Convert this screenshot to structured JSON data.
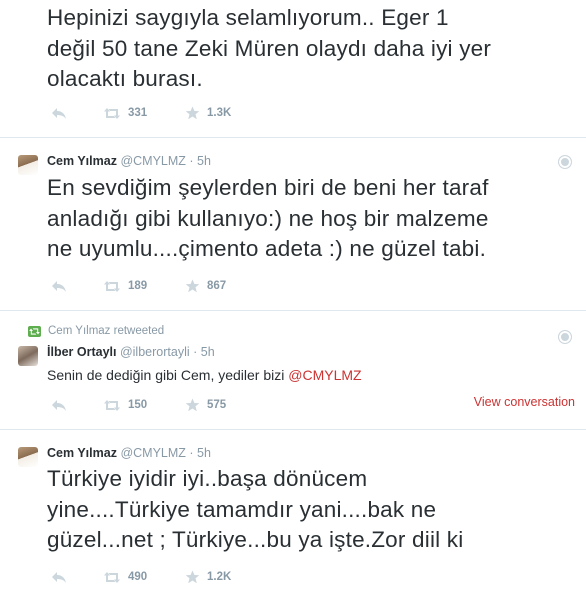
{
  "colors": {
    "accent": "#cc3333",
    "muted": "#8899a6",
    "text": "#292f33",
    "divider": "#e1e8ed"
  },
  "icons": {
    "reply": "reply-icon",
    "retweet": "retweet-icon",
    "favorite": "star-icon",
    "globe": "globe-icon"
  },
  "tweets": [
    {
      "text_lines": [
        "Hepinizi saygıyla selamlıyorum.. Eger 1",
        "değil 50 tane Zeki Müren olaydı daha iyi yer",
        "olacaktı burası."
      ],
      "retweets": "331",
      "favorites": "1.3K"
    },
    {
      "fullname": "Cem Yılmaz",
      "screen_name": "@CMYLMZ",
      "dot": "·",
      "time": "5h",
      "text_lines": [
        "En sevdiğim şeylerden biri de beni her taraf",
        "anladığı gibi kullanıyo:) ne hoş bir malzeme",
        "ne uyumlu....çimento adeta :) ne güzel tabi."
      ],
      "retweets": "189",
      "favorites": "867"
    },
    {
      "retweeted_by": "Cem Yılmaz retweeted",
      "fullname": "İlber Ortaylı",
      "screen_name": "@ilberortayli",
      "dot": "·",
      "time": "5h",
      "text": "Senin de dediğin gibi Cem, yediler bizi ",
      "mention": "@CMYLMZ",
      "retweets": "150",
      "favorites": "575",
      "view_conversation": "View conversation"
    },
    {
      "fullname": "Cem Yılmaz",
      "screen_name": "@CMYLMZ",
      "dot": "·",
      "time": "5h",
      "text_lines": [
        "Türkiye iyidir iyi..başa dönücem",
        "yine....Türkiye tamamdır yani....bak ne",
        "güzel...net ; Türkiye...bu ya işte.Zor diil ki"
      ],
      "retweets": "490",
      "favorites": "1.2K"
    }
  ]
}
